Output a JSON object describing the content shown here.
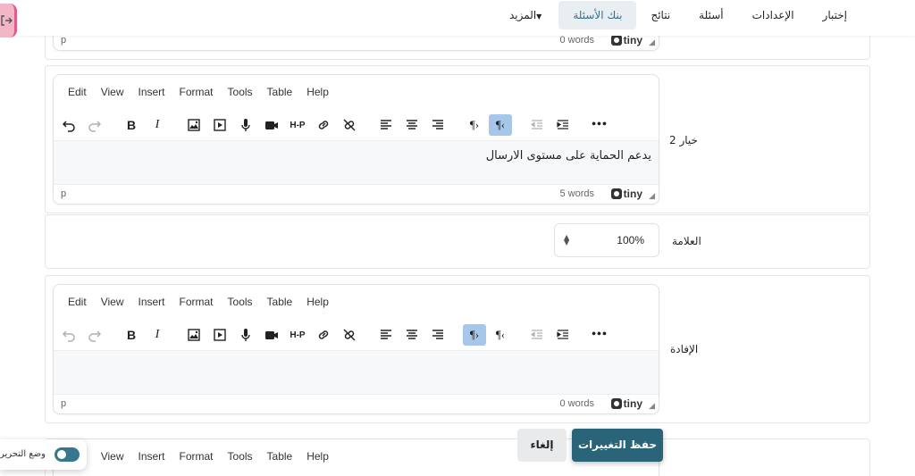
{
  "nav": {
    "tabs": [
      {
        "label": "إختبار"
      },
      {
        "label": "الإعدادات"
      },
      {
        "label": "أسئلة"
      },
      {
        "label": "نتائج"
      },
      {
        "label": "بنك الأسئلة",
        "active": true
      },
      {
        "label": "المزيد"
      }
    ]
  },
  "editors": {
    "menu": [
      "Edit",
      "View",
      "Insert",
      "Format",
      "Tools",
      "Table",
      "Help"
    ],
    "top_partial": {
      "path": "p",
      "words": "0 words",
      "brand": "tiny"
    },
    "option2": {
      "label": "خيار 2",
      "content": "يدعم الحماية على مستوى الارسال",
      "path": "p",
      "words": "5 words",
      "brand": "tiny"
    },
    "feedback": {
      "label": "الإفادة",
      "content": "",
      "path": "p",
      "words": "0 words",
      "brand": "tiny"
    }
  },
  "grade": {
    "label": "العلامة",
    "value": "100%"
  },
  "actions": {
    "save": "حفظ التغييرات",
    "cancel": "إلغاء"
  },
  "edit_mode": {
    "label": "وضع التحرير",
    "on": true
  },
  "colors": {
    "primary": "#2a6479",
    "tab_active_bg": "#e9eef2",
    "toolbar_active": "#a7c7ea"
  }
}
